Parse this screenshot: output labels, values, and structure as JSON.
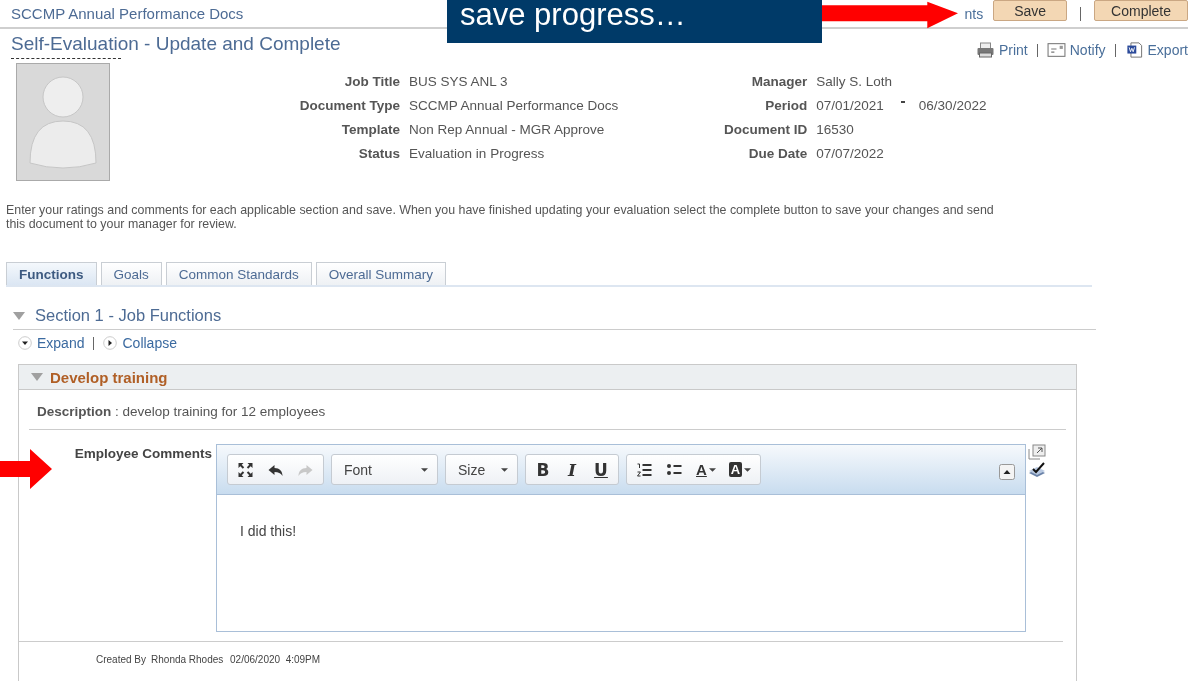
{
  "header": {
    "breadcrumb": "SCCMP Annual Performance Docs",
    "cut_link": "nts",
    "buttons": [
      {
        "label": "Save"
      },
      {
        "label": "Complete"
      }
    ]
  },
  "callout": {
    "text": "save progress…"
  },
  "title": "Self-Evaluation - Update and Complete",
  "actions": [
    {
      "label": "Print",
      "kind": "print"
    },
    {
      "label": "Notify",
      "kind": "notify"
    },
    {
      "label": "Export",
      "kind": "export"
    }
  ],
  "info_left": [
    {
      "label": "Job Title",
      "value": "BUS SYS ANL 3"
    },
    {
      "label": "Document Type",
      "value": "SCCMP Annual Performance Docs"
    },
    {
      "label": "Template",
      "value": "Non Rep Annual - MGR Approve"
    },
    {
      "label": "Status",
      "value": "Evaluation in Progress"
    }
  ],
  "info_right": [
    {
      "label": "Manager",
      "value": "Sally S. Loth"
    },
    {
      "label": "Period",
      "value": "07/01/2021",
      "value_to": "06/30/2022"
    },
    {
      "label": "Document ID",
      "value": "16530"
    },
    {
      "label": "Due Date",
      "value": "07/07/2022"
    }
  ],
  "instructions": "Enter your ratings and comments for each applicable section and save. When you have finished updating your evaluation select the complete button to save your changes and send this document to your manager for review.",
  "tabs": [
    {
      "label": "Functions",
      "selected": true
    },
    {
      "label": "Goals",
      "selected": false
    },
    {
      "label": "Common Standards",
      "selected": false
    },
    {
      "label": "Overall Summary",
      "selected": false
    }
  ],
  "section": {
    "title": "Section 1 - Job Functions",
    "expanded": true,
    "links": [
      "Expand",
      "Collapse"
    ]
  },
  "panel": {
    "title": "Develop training",
    "expanded": true,
    "description": "**Description** : develop training for 12 employees"
  },
  "comments": {
    "label": "Employee Comments",
    "font": "Font",
    "size": "Size",
    "format_buttons": [
      "B",
      "I",
      "U"
    ],
    "text_color": "A",
    "highlight": "A",
    "text": "I did this!"
  },
  "footer": {
    "created_by_label": "Created By",
    "created_by": "Rhonda Rhodes",
    "created_at": "02/06/2020  4:09PM"
  }
}
